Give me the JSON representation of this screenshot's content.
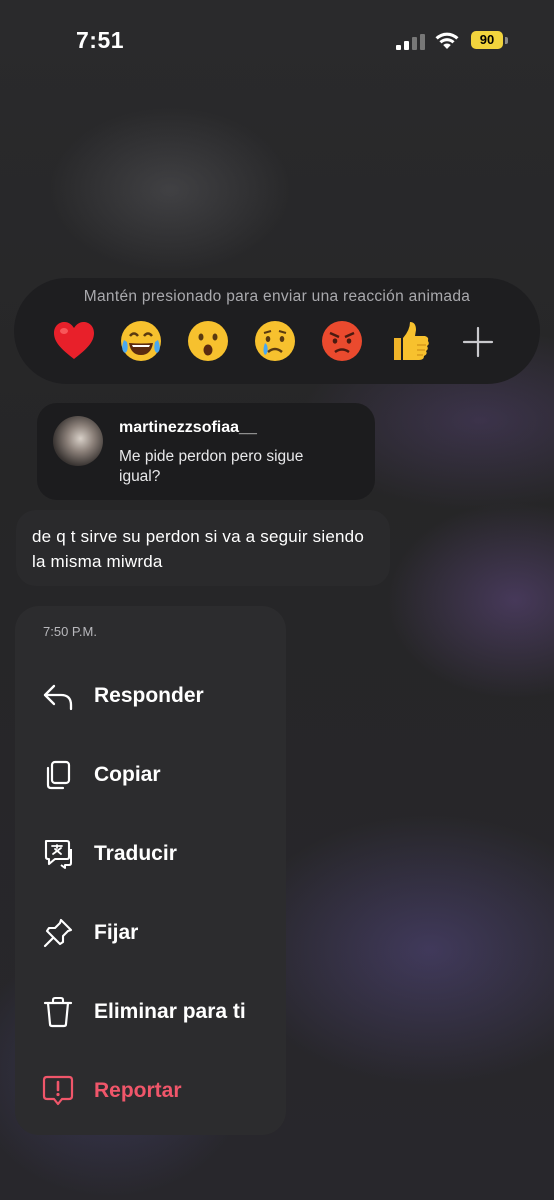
{
  "status_bar": {
    "time": "7:51",
    "battery": "90",
    "battery_color": "#f2d43d"
  },
  "reactions": {
    "hint": "Mantén presionado para enviar una reacción animada",
    "emojis": [
      {
        "name": "red-heart",
        "char": "❤️"
      },
      {
        "name": "tears-of-joy",
        "char": "😂"
      },
      {
        "name": "astonished",
        "char": "😮"
      },
      {
        "name": "crying",
        "char": "😢"
      },
      {
        "name": "angry",
        "char": "😡"
      },
      {
        "name": "thumbs-up",
        "char": "👍"
      }
    ],
    "more_icon": "plus-icon"
  },
  "reply": {
    "username": "martinezzsofiaa__",
    "text": "Me pide perdon pero sigue igual?"
  },
  "message": {
    "text": "de q t sirve su perdon si va a seguir siendo la misma miwrda"
  },
  "menu": {
    "timestamp": "7:50 P.M.",
    "items": [
      {
        "label": "Responder",
        "icon": "reply-icon"
      },
      {
        "label": "Copiar",
        "icon": "copy-icon"
      },
      {
        "label": "Traducir",
        "icon": "translate-icon"
      },
      {
        "label": "Fijar",
        "icon": "pin-icon"
      },
      {
        "label": "Eliminar para ti",
        "icon": "trash-icon"
      },
      {
        "label": "Reportar",
        "icon": "report-icon",
        "color": "#f0566a"
      }
    ]
  }
}
